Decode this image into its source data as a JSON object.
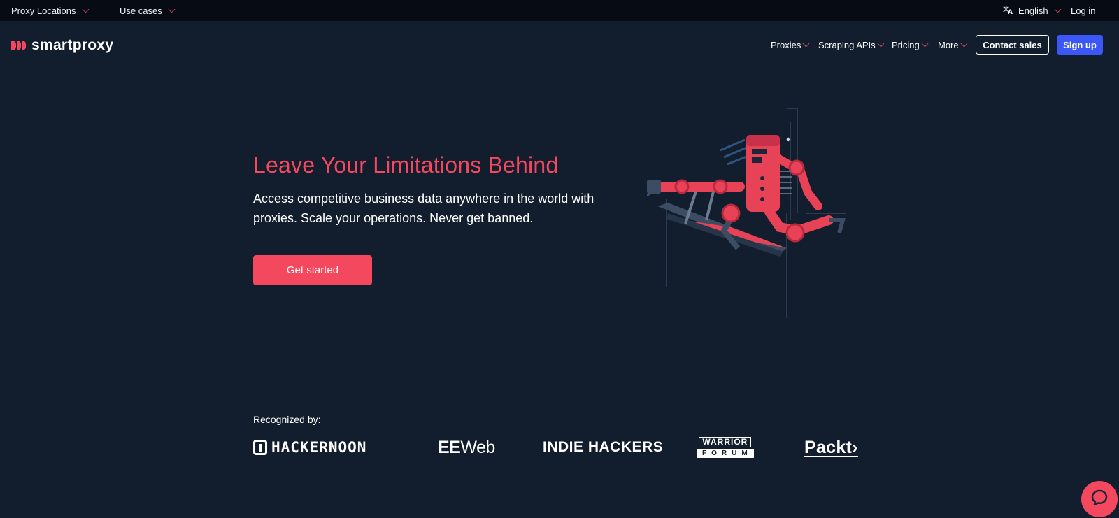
{
  "topbar": {
    "proxy_locations": "Proxy Locations",
    "use_cases": "Use cases",
    "language": "English",
    "login": "Log in"
  },
  "nav": {
    "logo_text": "smartproxy",
    "proxies": "Proxies",
    "scraping_apis": "Scraping APIs",
    "pricing": "Pricing",
    "more": "More",
    "contact_sales": "Contact sales",
    "sign_up": "Sign up"
  },
  "hero": {
    "title": "Leave Your Limitations Behind",
    "subtitle": "Access competitive business data anywhere in the world with proxies. Scale your operations. Never get banned.",
    "cta": "Get started"
  },
  "recognized": {
    "label": "Recognized by:",
    "partners": {
      "hackernoon": "HACKERNOON",
      "eeweb_bold": "EE",
      "eeweb_rest": "Web",
      "indie_hackers": "INDIE HACKERS",
      "warrior": "WARRIOR",
      "forum": "FORUM",
      "packt": "Packt›"
    }
  },
  "colors": {
    "background": "#121d2d",
    "topbar": "#070c14",
    "accent": "#f4485f",
    "signup": "#3b57f5"
  },
  "icons": {
    "language": "translate-icon",
    "chat": "chat-bubble-icon",
    "chevron": "chevron-down-icon"
  }
}
